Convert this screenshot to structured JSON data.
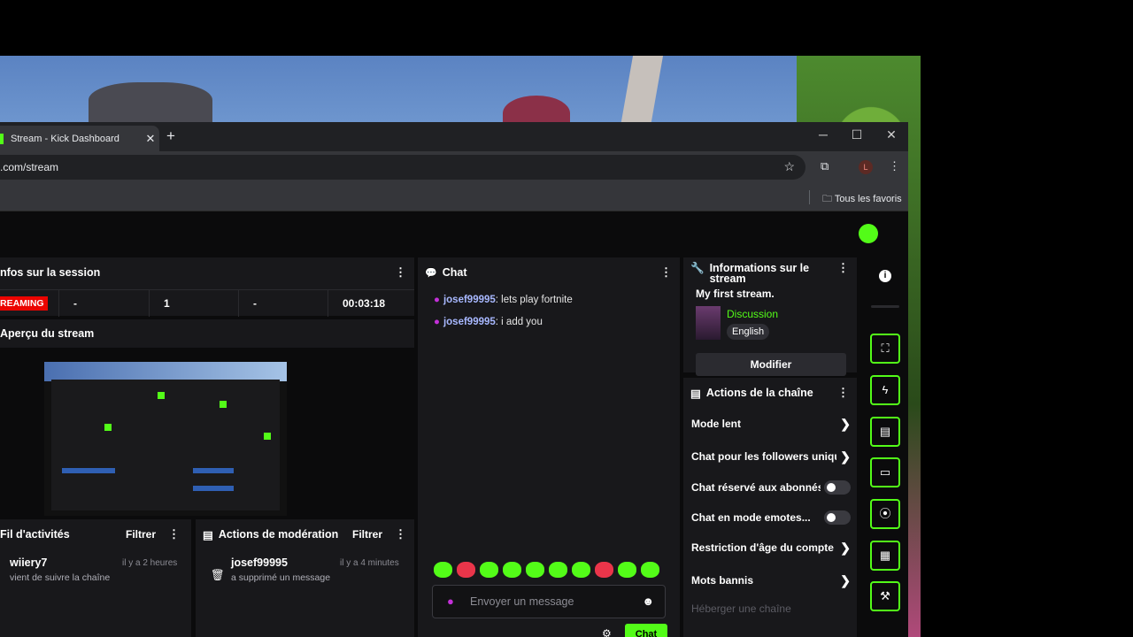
{
  "browser": {
    "tab_title": "Stream - Kick Dashboard",
    "url": ".com/stream",
    "bookmark_folder": "Tous les favoris",
    "profile_initial": "L"
  },
  "session": {
    "title": "nfos sur la session",
    "status": "REAMING",
    "stat1": "-",
    "stat2": "1",
    "stat3": "-",
    "duration": "00:03:18"
  },
  "preview": {
    "title": "Aperçu du stream"
  },
  "activity": {
    "title": "Fil d'activités",
    "filter": "Filtrer",
    "user": "wiiery7",
    "desc": "vient de suivre la chaîne",
    "time": "il y a 2 heures"
  },
  "moderation": {
    "title": "Actions de modération",
    "filter": "Filtrer",
    "user": "josef99995",
    "desc": "a supprimé un message",
    "time": "il y a 4 minutes"
  },
  "chat": {
    "title": "Chat",
    "messages": [
      {
        "user": "josef99995",
        "text": ": lets play fortnite"
      },
      {
        "user": "josef99995",
        "text": ": i add you"
      }
    ],
    "placeholder": "Envoyer un message",
    "send_label": "Chat"
  },
  "stream_info": {
    "title": "Informations sur le stream",
    "stream_title": "My first stream.",
    "category": "Discussion",
    "language": "English",
    "edit_label": "Modifier"
  },
  "channel_actions": {
    "title": "Actions de la chaîne",
    "items": [
      "Mode lent",
      "Chat pour les followers uniquement",
      "Chat réservé aux abonnés",
      "Chat en mode emotes...",
      "Restriction d'âge du compte",
      "Mots bannis",
      "Héberger une chaîne"
    ]
  },
  "colors": {
    "accent": "#53fc18",
    "live": "#eb0400",
    "panel": "#18181b"
  }
}
